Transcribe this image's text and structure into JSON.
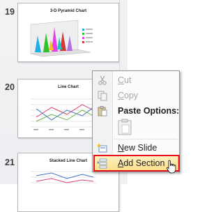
{
  "slides": [
    {
      "number": "19",
      "title": "3-D Pyramid Chart"
    },
    {
      "number": "20",
      "title": "Line Chart"
    },
    {
      "number": "21",
      "title": "Stacked Line Chart"
    }
  ],
  "context_menu": {
    "items": {
      "cut": "Cut",
      "copy": "Copy",
      "paste_options": "Paste Options:",
      "new_slide": "New Slide",
      "add_section": "Add Section"
    }
  },
  "icons": {
    "cut": "scissors-icon",
    "copy": "copy-icon",
    "paste_options": "paste-icon",
    "paste_keep": "clipboard-icon",
    "new_slide": "new-slide-icon",
    "add_section": "section-icon"
  },
  "colors": {
    "highlight_fill": "#fbe19a",
    "highlight_border": "#e6b94b",
    "callout_red": "#e8111a"
  }
}
